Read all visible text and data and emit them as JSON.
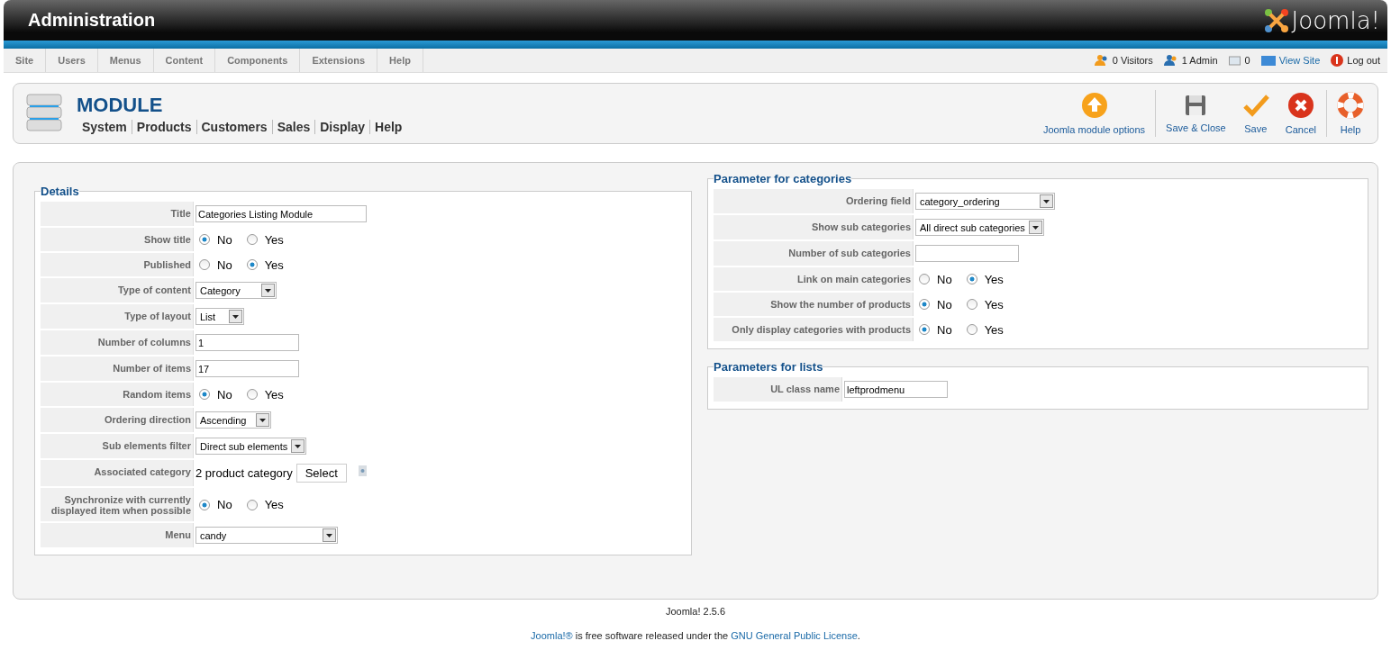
{
  "header": {
    "title": "Administration",
    "logo_text": "Joomla!"
  },
  "menu": [
    {
      "label": "Site"
    },
    {
      "label": "Users"
    },
    {
      "label": "Menus"
    },
    {
      "label": "Content"
    },
    {
      "label": "Components"
    },
    {
      "label": "Extensions"
    },
    {
      "label": "Help"
    }
  ],
  "status": [
    {
      "kind": "visitors",
      "label": "0 Visitors"
    },
    {
      "kind": "admin",
      "label": "1 Admin"
    },
    {
      "kind": "messages",
      "label": "0"
    },
    {
      "kind": "viewsite",
      "label": "View Site"
    },
    {
      "kind": "logout",
      "label": "Log out"
    }
  ],
  "toolbar": {
    "title": "MODULE",
    "submenu": [
      "System",
      "Products",
      "Customers",
      "Sales",
      "Display",
      "Help"
    ],
    "buttons": [
      {
        "kind": "options",
        "label": "Joomla module options"
      },
      {
        "kind": "sep"
      },
      {
        "kind": "save-close",
        "label": "Save & Close"
      },
      {
        "kind": "save",
        "label": "Save"
      },
      {
        "kind": "cancel",
        "label": "Cancel"
      },
      {
        "kind": "sep"
      },
      {
        "kind": "help",
        "label": "Help"
      }
    ]
  },
  "details": {
    "legend": "Details",
    "fields": [
      {
        "label": "Title",
        "kind": "text",
        "value": "Categories Listing Module"
      },
      {
        "label": "Show title",
        "kind": "radio",
        "options": [
          {
            "label": "No",
            "selected": true
          },
          {
            "label": "Yes",
            "selected": false
          }
        ]
      },
      {
        "label": "Published",
        "kind": "radio",
        "options": [
          {
            "label": "No",
            "selected": false
          },
          {
            "label": "Yes",
            "selected": true
          }
        ]
      },
      {
        "label": "Type of content",
        "kind": "select",
        "value": "Category"
      },
      {
        "label": "Type of layout",
        "kind": "select",
        "value": "List"
      },
      {
        "label": "Number of columns",
        "kind": "text",
        "value": "1"
      },
      {
        "label": "Number of items",
        "kind": "text",
        "value": "17"
      },
      {
        "label": "Random items",
        "kind": "radio",
        "options": [
          {
            "label": "No",
            "selected": true
          },
          {
            "label": "Yes",
            "selected": false
          }
        ]
      },
      {
        "label": "Ordering direction",
        "kind": "select",
        "value": "Ascending"
      },
      {
        "label": "Sub elements filter",
        "kind": "select",
        "value": "Direct sub elements"
      },
      {
        "label": "Associated category",
        "kind": "category",
        "value": "2 product category",
        "button": "Select"
      },
      {
        "label": "Synchronize with currently displayed item when possible",
        "kind": "radio",
        "options": [
          {
            "label": "No",
            "selected": true
          },
          {
            "label": "Yes",
            "selected": false
          }
        ]
      },
      {
        "label": "Menu",
        "kind": "select",
        "value": "candy"
      }
    ]
  },
  "categories": {
    "legend": "Parameter for categories",
    "fields": [
      {
        "label": "Ordering field",
        "kind": "select",
        "value": "category_ordering"
      },
      {
        "label": "Show sub categories",
        "kind": "select",
        "value": "All direct sub categories"
      },
      {
        "label": "Number of sub categories",
        "kind": "text"
      },
      {
        "label": "Link on main categories",
        "kind": "radio",
        "options": [
          {
            "label": "No",
            "selected": false
          },
          {
            "label": "Yes",
            "selected": true
          }
        ]
      },
      {
        "label": "Show the number of products",
        "kind": "radio",
        "options": [
          {
            "label": "No",
            "selected": true
          },
          {
            "label": "Yes",
            "selected": false
          }
        ]
      },
      {
        "label": "Only display categories with products",
        "kind": "radio",
        "options": [
          {
            "label": "No",
            "selected": true
          },
          {
            "label": "Yes",
            "selected": false
          }
        ]
      }
    ]
  },
  "lists": {
    "legend": "Parameters for lists",
    "fields": [
      {
        "label": "UL class name",
        "kind": "text",
        "value": "leftprodmenu"
      }
    ]
  },
  "footer": {
    "version": "Joomla! 2.5.6",
    "license": [
      {
        "kind": "link",
        "text": "Joomla!®"
      },
      {
        "kind": "text",
        "text": " is free software released under the "
      },
      {
        "kind": "link",
        "text": "GNU General Public License"
      },
      {
        "kind": "text",
        "text": "."
      }
    ]
  }
}
